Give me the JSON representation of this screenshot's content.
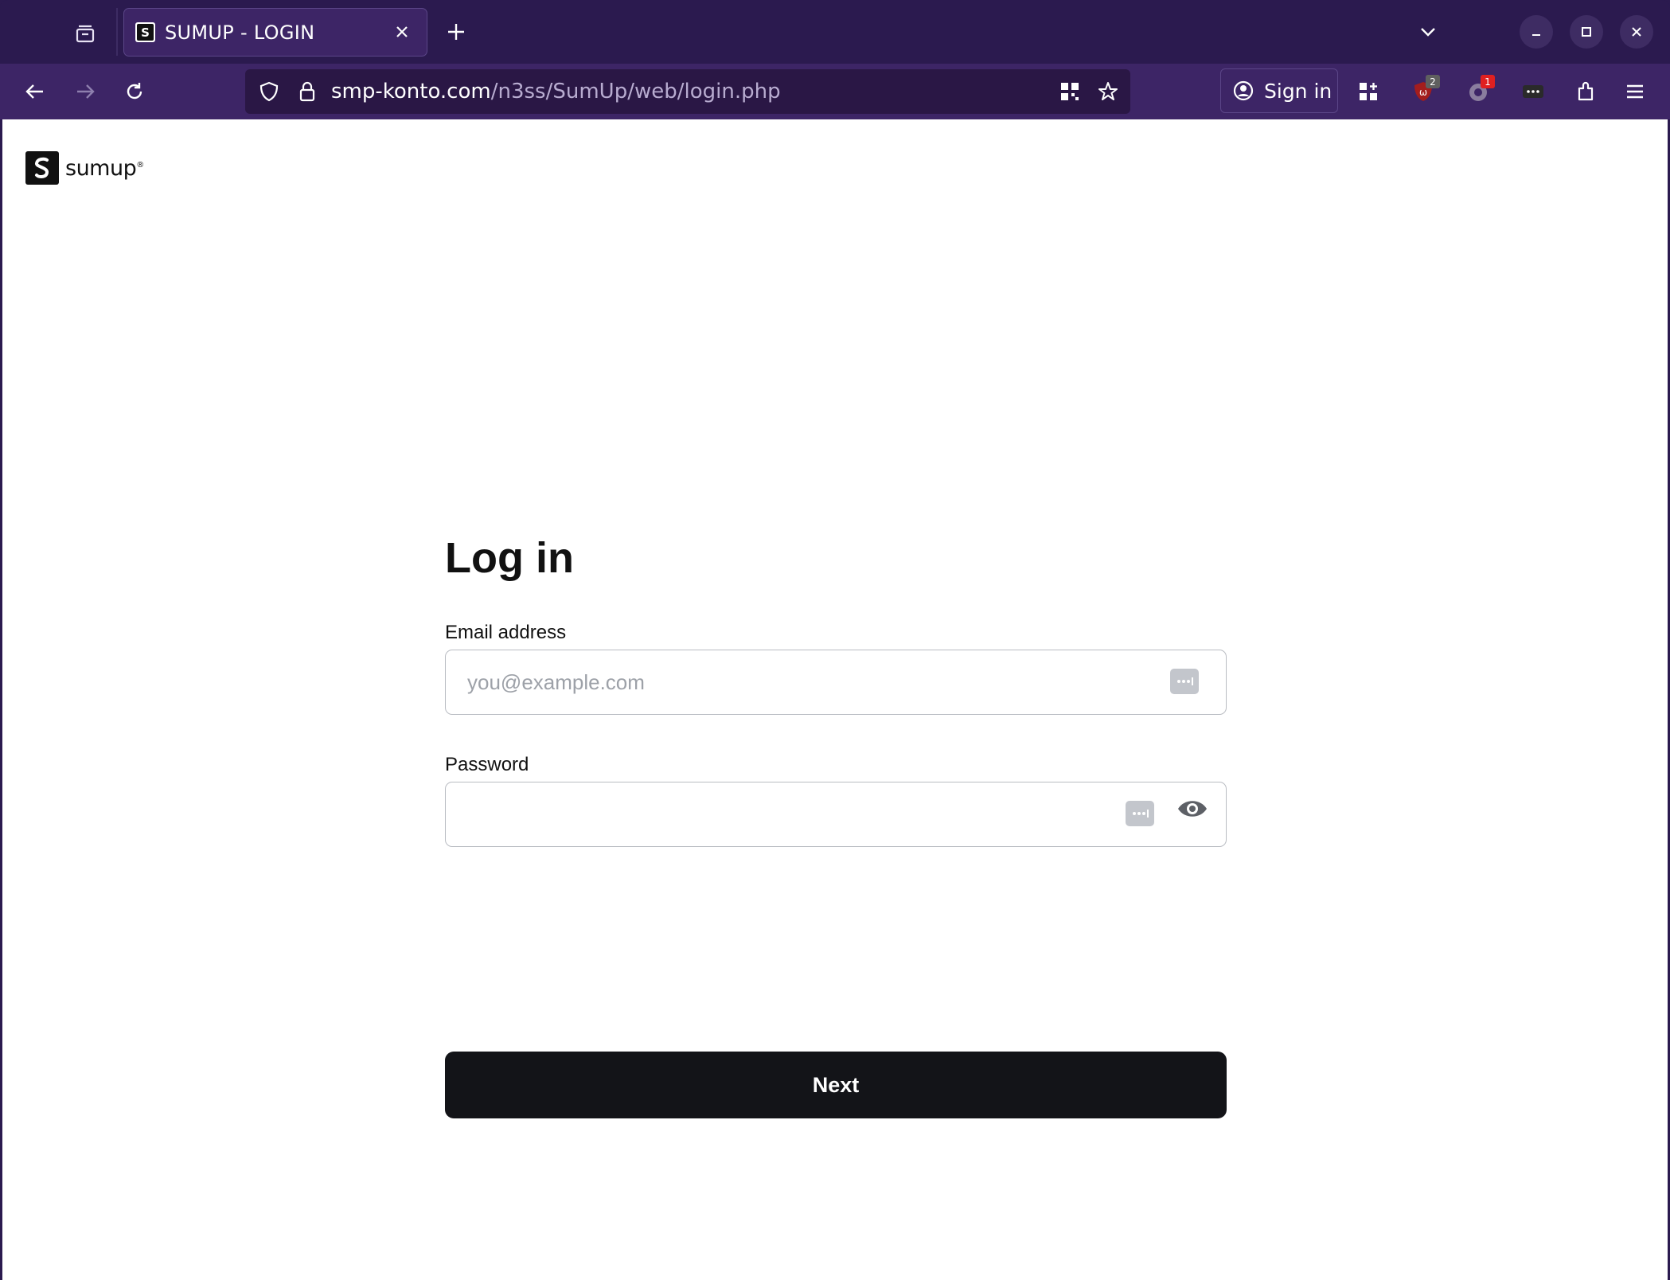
{
  "browser": {
    "tab": {
      "title": "SUMUP - LOGIN",
      "favicon_glyph": "S"
    },
    "url": {
      "domain": "smp-konto.com",
      "path": "/n3ss/SumUp/web/login.php"
    },
    "signin_label": "Sign in",
    "extensions": [
      {
        "name": "ublock-icon",
        "badge": "2",
        "badge_color": "#5f5f5f"
      },
      {
        "name": "extension-icon",
        "badge": "1",
        "badge_color": "#e02020"
      }
    ],
    "colors": {
      "frame": "#2b1a4f",
      "toolbar": "#3d2566",
      "urlbar": "#2a1745"
    }
  },
  "page": {
    "logo": {
      "mark": "S",
      "text": "sumup",
      "tm": "®"
    },
    "heading": "Log in",
    "email": {
      "label": "Email address",
      "placeholder": "you@example.com",
      "value": ""
    },
    "password": {
      "label": "Password",
      "value": ""
    },
    "next_button": "Next",
    "colors": {
      "button": "#131418",
      "field_border": "#b9bcc2"
    }
  }
}
